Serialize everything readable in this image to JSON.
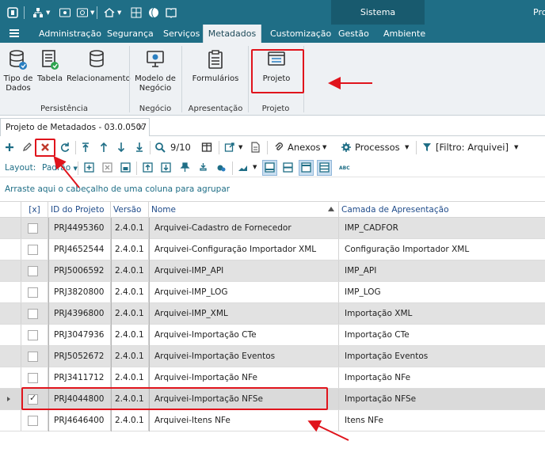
{
  "title_bar": {
    "system_tab": "Sistema",
    "user": "Pro"
  },
  "menu": {
    "items": [
      "Administração",
      "Segurança",
      "Serviços",
      "Metadados",
      "Customização",
      "Gestão",
      "Ambiente"
    ],
    "active": "Metadados"
  },
  "ribbon": {
    "buttons": {
      "tipo_de_dados": [
        "Tipo de",
        "Dados"
      ],
      "tabela": "Tabela",
      "relacionamento": "Relacionamento",
      "modelo_de_negocio": [
        "Modelo de",
        "Negócio"
      ],
      "formularios": "Formulários",
      "projeto": "Projeto"
    },
    "groups": {
      "persistencia": "Persistência",
      "negocio": "Negócio",
      "apresentacao": "Apresentação",
      "projeto": "Projeto"
    }
  },
  "document_tab": {
    "label": "Projeto de Metadados - 03.0.0507",
    "close": "×"
  },
  "toolbar": {
    "page_counter": "9/10",
    "anexos": "Anexos",
    "processos": "Processos",
    "filtro": "[Filtro: Arquivei]"
  },
  "layout_bar": {
    "label": "Layout:",
    "value": "Padrão"
  },
  "group_panel": {
    "hint": "Arraste aqui o cabeçalho de uma coluna para agrupar"
  },
  "grid": {
    "columns": {
      "check": "[x]",
      "id": "ID do Projeto",
      "versao": "Versão",
      "nome": "Nome",
      "camada": "Camada de Apresentação"
    },
    "rows": [
      {
        "id": "PRJ4495360",
        "versao": "2.4.0.1",
        "nome": "Arquivei-Cadastro de Fornecedor",
        "camada": "IMP_CADFOR",
        "checked": false
      },
      {
        "id": "PRJ4652544",
        "versao": "2.4.0.1",
        "nome": "Arquivei-Configuração Importador XML",
        "camada": "Configuração Importador XML",
        "checked": false
      },
      {
        "id": "PRJ5006592",
        "versao": "2.4.0.1",
        "nome": "Arquivei-IMP_API",
        "camada": "IMP_API",
        "checked": false
      },
      {
        "id": "PRJ3820800",
        "versao": "2.4.0.1",
        "nome": "Arquivei-IMP_LOG",
        "camada": "IMP_LOG",
        "checked": false
      },
      {
        "id": "PRJ4396800",
        "versao": "2.4.0.1",
        "nome": "Arquivei-IMP_XML",
        "camada": "Importação XML",
        "checked": false
      },
      {
        "id": "PRJ3047936",
        "versao": "2.4.0.1",
        "nome": "Arquivei-Importação CTe",
        "camada": "Importação CTe",
        "checked": false
      },
      {
        "id": "PRJ5052672",
        "versao": "2.4.0.1",
        "nome": "Arquivei-Importação Eventos",
        "camada": "Importação Eventos",
        "checked": false
      },
      {
        "id": "PRJ3411712",
        "versao": "2.4.0.1",
        "nome": "Arquivei-Importação NFe",
        "camada": "Importação NFe",
        "checked": false
      },
      {
        "id": "PRJ4044800",
        "versao": "2.4.0.1",
        "nome": "Arquivei-Importação NFSe",
        "camada": "Importação NFSe",
        "checked": true
      },
      {
        "id": "PRJ4646400",
        "versao": "2.4.0.1",
        "nome": "Arquivei-Itens NFe",
        "camada": "Itens NFe",
        "checked": false
      }
    ]
  },
  "colors": {
    "header_bg": "#1f6e86",
    "ribbon_bg": "#eef1f4",
    "annotation_red": "#e0141c"
  }
}
